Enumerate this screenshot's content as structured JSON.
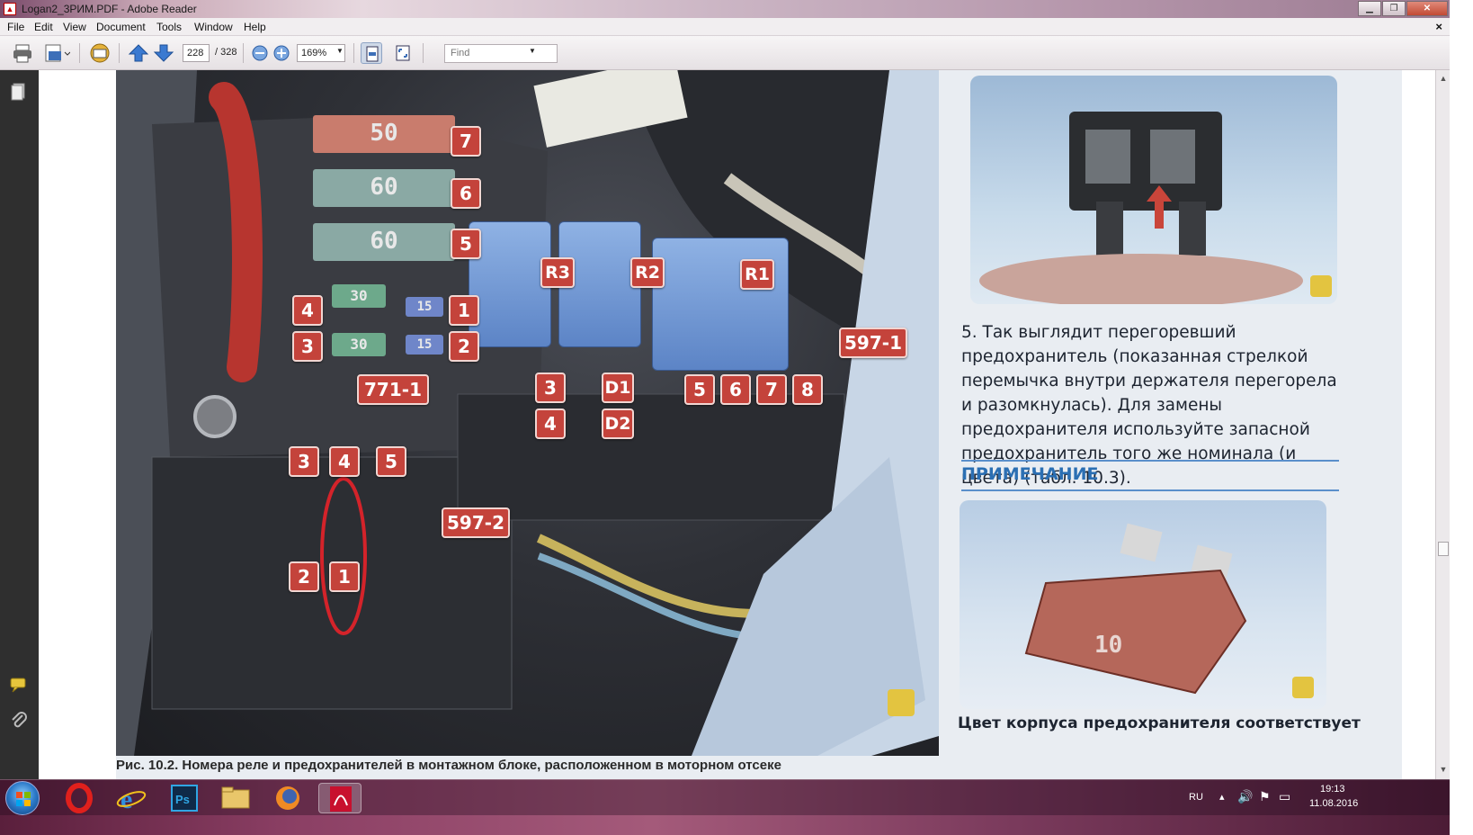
{
  "window": {
    "title": "Logan2_3PИМ.PDF - Adobe Reader"
  },
  "menu": {
    "items": [
      "File",
      "Edit",
      "View",
      "Document",
      "Tools",
      "Window",
      "Help"
    ],
    "close": "×"
  },
  "toolbar": {
    "page_current": "228",
    "page_total": "/ 328",
    "zoom": "169%",
    "find_placeholder": "Find",
    "icons": [
      "print-icon",
      "save-icon",
      "email-icon",
      "prev-page-icon",
      "next-page-icon",
      "zoom-out-icon",
      "zoom-in-icon",
      "fit-page-icon",
      "full-screen-icon"
    ]
  },
  "photo": {
    "fuse_labels": {
      "f50": "50",
      "f60a": "60",
      "f60b": "60",
      "f30a": "30",
      "f30b": "30",
      "f15a": "15",
      "f15b": "15"
    },
    "labels": [
      "7",
      "6",
      "5",
      "4",
      "3",
      "1",
      "2",
      "771-1",
      "3",
      "4",
      "5",
      "2",
      "1",
      "R3",
      "R2",
      "R1",
      "3",
      "D1",
      "4",
      "D2",
      "5",
      "6",
      "7",
      "8",
      "597-1",
      "597-2"
    ],
    "caption": "Рис. 10.2. Номера реле и предохранителей в монтажном блоке, расположенном в моторном отсеке"
  },
  "right": {
    "paragraph": "5. Так выглядит перегоревший предохранитель (показанная стрелкой перемычка внутри держателя перегорела и разомкнулась). Для замены предохранителя используйте запасной предохранитель того же номинала (и цвета) (табл. 10.3).",
    "note_title": "ПРИМЕЧАНИЕ",
    "fuse_value": "10",
    "bottom_text": "Цвет корпуса предохранителя соответствует"
  },
  "taskbar": {
    "apps": [
      "opera-icon",
      "internet-explorer-icon",
      "photoshop-icon",
      "file-explorer-icon",
      "firefox-icon",
      "adobe-reader-icon"
    ],
    "lang": "RU",
    "time": "19:13",
    "date": "11.08.2016"
  },
  "colors": {
    "label_red": "#c4433b",
    "relay_blue": "#7ea3dc",
    "note_blue": "#2b6fb3"
  }
}
